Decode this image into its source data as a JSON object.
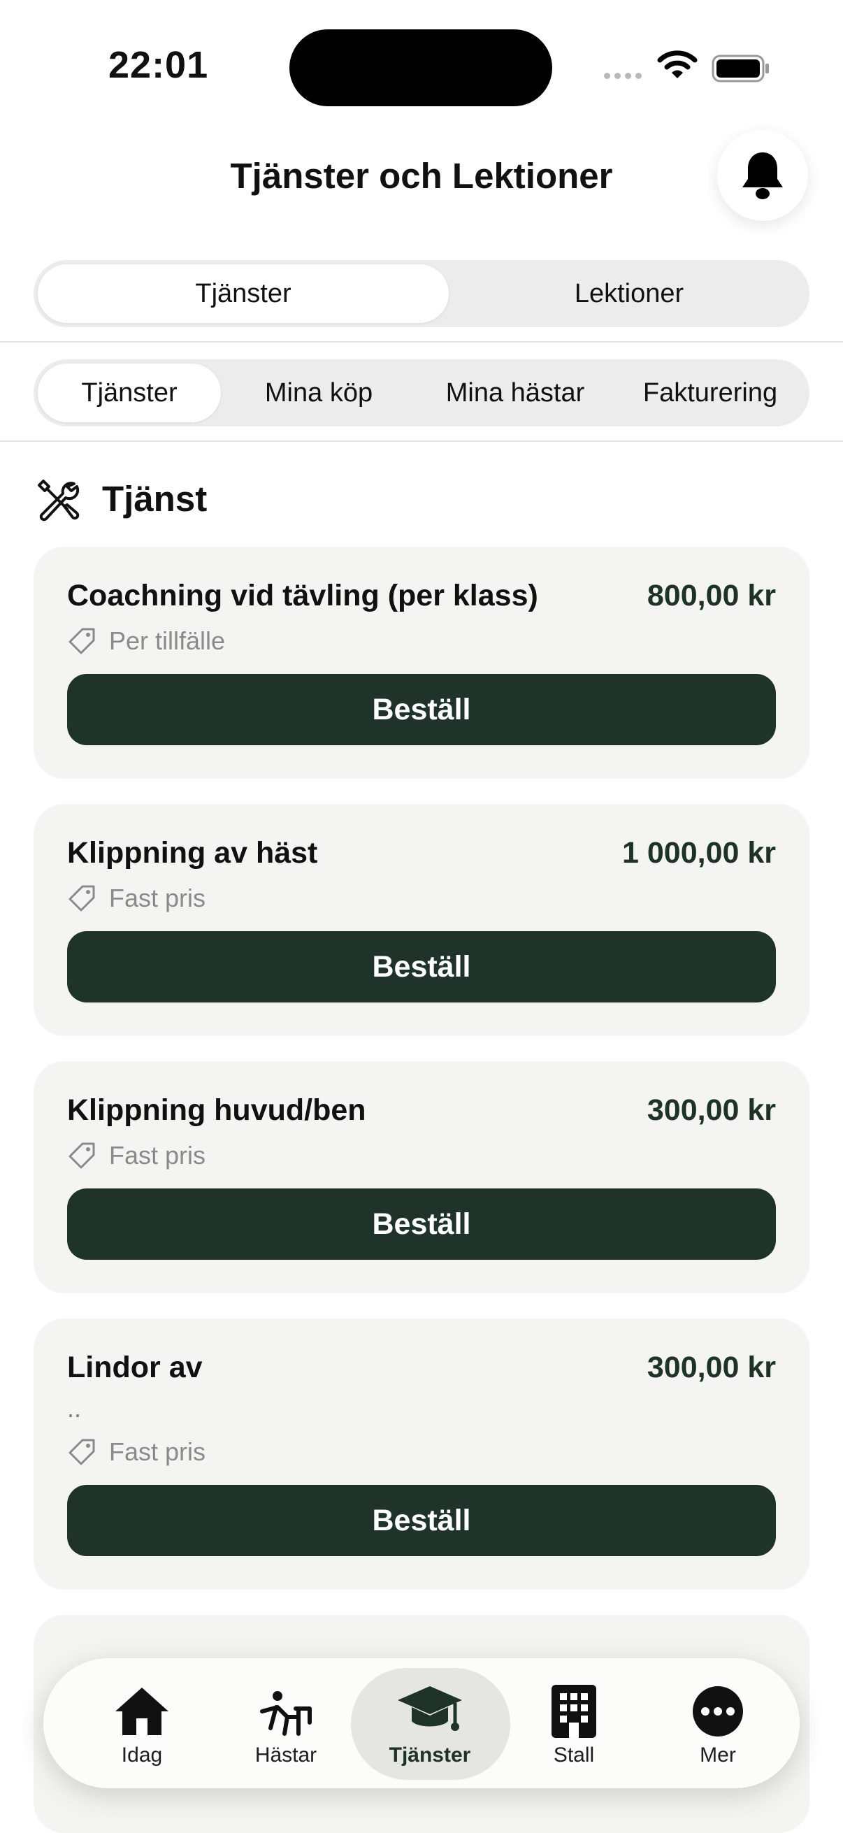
{
  "status_bar": {
    "time": "22:01"
  },
  "header": {
    "title": "Tjänster och Lektioner"
  },
  "main_segment": {
    "items": [
      "Tjänster",
      "Lektioner"
    ],
    "selected": "Tjänster"
  },
  "sub_segment": {
    "items": [
      "Tjänster",
      "Mina köp",
      "Mina hästar",
      "Fakturering"
    ],
    "selected": "Tjänster"
  },
  "section": {
    "title": "Tjänst",
    "icon": "tools-icon"
  },
  "services": [
    {
      "name": "Coachning vid tävling (per klass)",
      "price": "800,00 kr",
      "description": "",
      "pricing_type": "Per tillfälle",
      "button_label": "Beställ"
    },
    {
      "name": "Klippning av häst",
      "price": "1 000,00 kr",
      "description": "",
      "pricing_type": "Fast pris",
      "button_label": "Beställ"
    },
    {
      "name": "Klippning huvud/ben",
      "price": "300,00 kr",
      "description": "",
      "pricing_type": "Fast pris",
      "button_label": "Beställ"
    },
    {
      "name": "Lindor av",
      "price": "300,00 kr",
      "description": "..",
      "pricing_type": "Fast pris",
      "button_label": "Beställ"
    }
  ],
  "tab_bar": {
    "items": [
      {
        "label": "Idag",
        "icon": "house-icon"
      },
      {
        "label": "Hästar",
        "icon": "rider-icon"
      },
      {
        "label": "Tjänster",
        "icon": "graduation-cap-icon"
      },
      {
        "label": "Stall",
        "icon": "building-icon"
      },
      {
        "label": "Mer",
        "icon": "more-icon"
      }
    ],
    "selected": "Tjänster"
  },
  "colors": {
    "accent": "#1f332a",
    "card_bg": "#f4f4f2",
    "price": "#1e3228"
  }
}
